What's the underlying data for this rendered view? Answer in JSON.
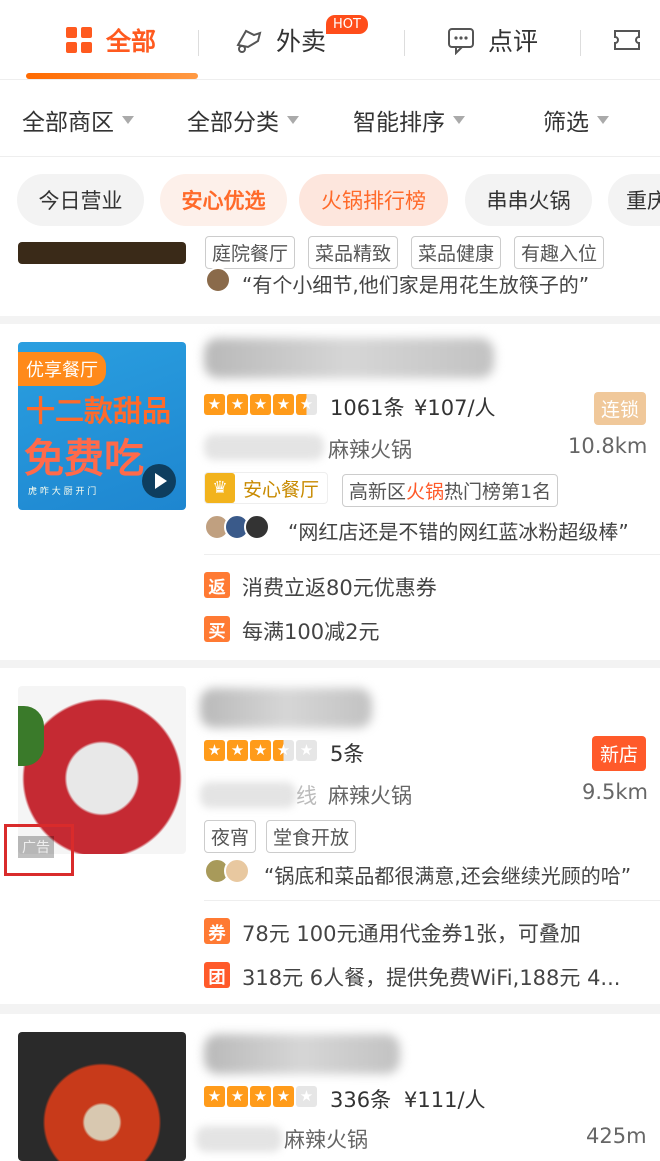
{
  "top_tabs": [
    {
      "label": "全部",
      "active": true
    },
    {
      "label": "外卖",
      "badge": "HOT"
    },
    {
      "label": "点评"
    }
  ],
  "filters": [
    "全部商区",
    "全部分类",
    "智能排序",
    "筛选"
  ],
  "chips": [
    "今日营业",
    "安心优选",
    "火锅排行榜",
    "串串火锅",
    "重庆"
  ],
  "partial_card": {
    "tags": [
      "庭院餐厅",
      "菜品精致",
      "菜品健康",
      "有趣入位"
    ],
    "review": "“有个小细节,他们家是用花生放筷子的”"
  },
  "cards": [
    {
      "thumb_badge": "优享餐厅",
      "thumb_lines": [
        "十二款甜品",
        "免费吃",
        "虎  咋  大  厨  开  门"
      ],
      "rating": 4.5,
      "reviews": "1061条",
      "price": "¥107/人",
      "badge": "连锁",
      "category": "麻辣火锅",
      "distance": "10.8km",
      "anxin": "安心餐厅",
      "rank_prefix": "高新区",
      "rank_hl": "火锅",
      "rank_suffix": "热门榜第1名",
      "review": "“网红店还是不错的网红蓝冰粉超级棒”",
      "promos": [
        {
          "icon": "返",
          "text": "消费立返80元优惠券"
        },
        {
          "icon": "买",
          "text": "每满100减2元"
        }
      ]
    },
    {
      "rating": 3.5,
      "reviews": "5条",
      "badge": "新店",
      "category_prefix": "线",
      "category": "麻辣火锅",
      "distance": "9.5km",
      "tags": [
        "夜宵",
        "堂食开放"
      ],
      "review": "“锅底和菜品都很满意,还会继续光顾的哈”",
      "ad": "广告",
      "promos": [
        {
          "icon": "券",
          "text": "78元 100元通用代金券1张，可叠加"
        },
        {
          "icon": "团",
          "text": "318元 6人餐，提供免费WiFi,188元 4..."
        }
      ]
    },
    {
      "rating": 4,
      "reviews": "336条",
      "price": "¥111/人",
      "category": "麻辣火锅",
      "distance": "425m"
    }
  ],
  "colors": {
    "accent": "#ff6a00",
    "star": "#ff9b1a",
    "ad_box": "#d92b2b"
  }
}
